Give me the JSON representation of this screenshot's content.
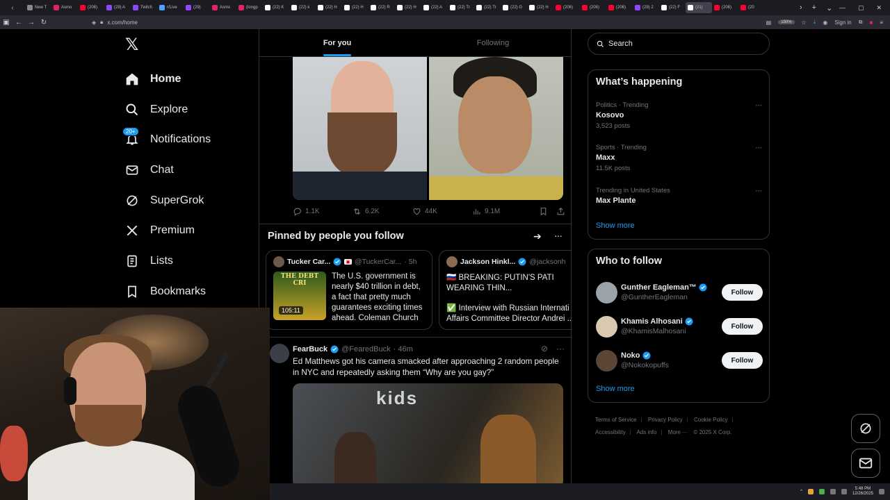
{
  "browser": {
    "tabs": [
      {
        "label": "New T",
        "color": "#888888",
        "active": false
      },
      {
        "label": "Asmo",
        "color": "#e0245e",
        "active": false
      },
      {
        "label": "(206)",
        "color": "#ff0033",
        "active": false
      },
      {
        "label": "(29) A",
        "color": "#9146ff",
        "active": false
      },
      {
        "label": "Twitch",
        "color": "#9146ff",
        "active": false
      },
      {
        "label": "r/Live",
        "color": "#4aa3ff",
        "active": false
      },
      {
        "label": "(29)",
        "color": "#9146ff",
        "active": false
      },
      {
        "label": "Asmo",
        "color": "#e0245e",
        "active": false
      },
      {
        "label": "(longp",
        "color": "#e0245e",
        "active": false
      },
      {
        "label": "(22) K",
        "color": "#ffffff",
        "active": false
      },
      {
        "label": "(22) k",
        "color": "#ffffff",
        "active": false
      },
      {
        "label": "(22) H",
        "color": "#ffffff",
        "active": false
      },
      {
        "label": "(22) H",
        "color": "#ffffff",
        "active": false
      },
      {
        "label": "(22) R",
        "color": "#ffffff",
        "active": false
      },
      {
        "label": "(22) H",
        "color": "#ffffff",
        "active": false
      },
      {
        "label": "(22) A",
        "color": "#ffffff",
        "active": false
      },
      {
        "label": "(22) Tr",
        "color": "#ffffff",
        "active": false
      },
      {
        "label": "(22) Tr",
        "color": "#ffffff",
        "active": false
      },
      {
        "label": "(22) G",
        "color": "#ffffff",
        "active": false
      },
      {
        "label": "(22) H",
        "color": "#ffffff",
        "active": false
      },
      {
        "label": "(206)",
        "color": "#ff0033",
        "active": false
      },
      {
        "label": "(206)",
        "color": "#ff0033",
        "active": false
      },
      {
        "label": "(206)",
        "color": "#ff0033",
        "active": false
      },
      {
        "label": "(29) 2",
        "color": "#9146ff",
        "active": false
      },
      {
        "label": "(22) F",
        "color": "#ffffff",
        "active": false
      },
      {
        "label": "(21)",
        "color": "#ffffff",
        "active": true
      },
      {
        "label": "(206)",
        "color": "#ff0033",
        "active": false
      },
      {
        "label": "(20",
        "color": "#ff0033",
        "active": false
      }
    ],
    "url": "x.com/home",
    "zoom": "150%",
    "sign_in": "Sign in"
  },
  "nav": {
    "logo": "𝕏",
    "items": [
      {
        "label": "Home",
        "icon": "home-icon",
        "active": true
      },
      {
        "label": "Explore",
        "icon": "search-icon",
        "active": false
      },
      {
        "label": "Notifications",
        "icon": "bell-icon",
        "active": false,
        "badge": "20+"
      },
      {
        "label": "Chat",
        "icon": "mail-icon",
        "active": false
      },
      {
        "label": "SuperGrok",
        "icon": "grok-icon",
        "active": false
      },
      {
        "label": "Premium",
        "icon": "x-icon",
        "active": false
      },
      {
        "label": "Lists",
        "icon": "list-icon",
        "active": false
      },
      {
        "label": "Bookmarks",
        "icon": "bookmark-icon",
        "active": false
      }
    ]
  },
  "feed": {
    "tabs": [
      {
        "label": "For you",
        "active": true
      },
      {
        "label": "Following",
        "active": false
      }
    ],
    "post_actions": {
      "replies": "1.1K",
      "reposts": "6.2K",
      "likes": "44K",
      "views": "9.1M"
    },
    "pinned": {
      "heading": "Pinned by people you follow",
      "cards": [
        {
          "name": "Tucker Car...",
          "handle": "@TuckerCar...",
          "time": "· 5h",
          "thumb_title": "THE DEBT CRI",
          "duration": "105:11",
          "text": "The U.S. government is nearly $40 trillion in debt, a fact that pretty much guarantees exciting times ahead. Coleman Church ..."
        },
        {
          "name": "Jackson Hinkl...",
          "handle": "@jacksonh",
          "line1": "🇷🇺 BREAKING: PUTIN'S PATI WEARING THIN...",
          "line2": "✅ Interview with Russian Internati Affairs Committee Director Andrei ..."
        }
      ]
    },
    "tweet": {
      "name": "FearBuck",
      "handle": "@FearedBuck",
      "time": "· 46m",
      "text": "Ed Matthews got his camera smacked after approaching 2 random people in NYC and repeatedly asking them “Why are you gay?”",
      "media_sign": "kids"
    }
  },
  "sidebar": {
    "search_placeholder": "Search",
    "happening": {
      "title": "What’s happening",
      "trends": [
        {
          "meta": "Politics · Trending",
          "name": "Kosovo",
          "count": "3,523 posts"
        },
        {
          "meta": "Sports · Trending",
          "name": "Maxx",
          "count": "11.5K posts"
        },
        {
          "meta": "Trending in United States",
          "name": "Max Plante",
          "count": ""
        }
      ],
      "show_more": "Show more"
    },
    "who_to_follow": {
      "title": "Who to follow",
      "accounts": [
        {
          "name": "Gunther Eagleman™",
          "handle": "@GuntherEagleman",
          "button": "Follow",
          "avatar_color": "#9aa3a8"
        },
        {
          "name": "Khamis Alhosani",
          "handle": "@KhamisMalhosani",
          "button": "Follow",
          "avatar_color": "#d9c9b0"
        },
        {
          "name": "Noko",
          "handle": "@Nokokopuffs",
          "button": "Follow",
          "avatar_color": "#5b4636"
        }
      ],
      "show_more": "Show more"
    },
    "footer": {
      "links": [
        "Terms of Service",
        "Privacy Policy",
        "Cookie Policy",
        "Accessibility",
        "Ads info",
        "More ···"
      ],
      "copyright": "© 2025 X Corp."
    }
  },
  "taskbar": {
    "time": "5:48 PM",
    "date": "12/26/2025"
  },
  "colors": {
    "accent": "#1d9bf0",
    "border": "#2f3336",
    "muted": "#71767b"
  }
}
